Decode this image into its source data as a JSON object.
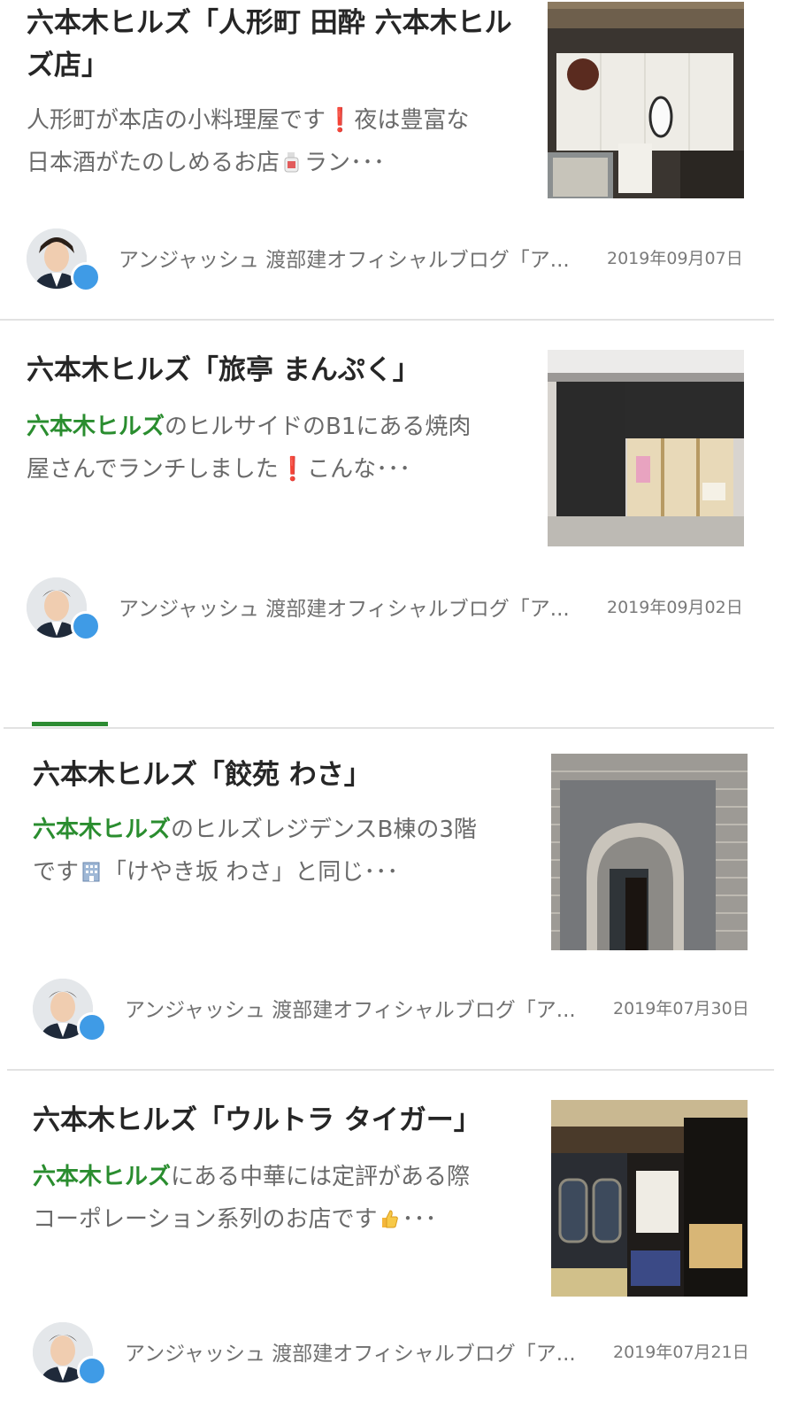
{
  "articles": [
    {
      "title": "六本木ヒルズ「人形町 田酔 六本木ヒルズ店」",
      "snippet_lead": "",
      "snippet_line1": "人形町が本店の小料理屋です❗夜は豊富な",
      "snippet_line2a": "日本酒がたのしめるお店",
      "snippet_line2b": "ラン･･･",
      "emoji_icon": "sake-bottle-icon",
      "author": "アンジャッシュ 渡部建オフィシャルブログ「ア...",
      "date": "2019年09月07日"
    },
    {
      "title": "六本木ヒルズ「旅亭 まんぷく」",
      "snippet_lead": "六本木ヒルズ",
      "snippet_line1": "のヒルサイドのB1にある焼肉",
      "snippet_line2a": "屋さんでランチしました❗こんな･･･",
      "author": "アンジャッシュ 渡部建オフィシャルブログ「ア...",
      "date": "2019年09月02日"
    },
    {
      "title": "六本木ヒルズ「餃苑 わさ」",
      "snippet_lead": "六本木ヒルズ",
      "snippet_line1": "のヒルズレジデンスB棟の3階",
      "snippet_line2a": "です",
      "snippet_line2b": "「けやき坂 わさ」と同じ･･･",
      "emoji_icon": "office-building-icon",
      "author": "アンジャッシュ 渡部建オフィシャルブログ「ア...",
      "date": "2019年07月30日"
    },
    {
      "title": "六本木ヒルズ「ウルトラ タイガー」",
      "snippet_lead": "六本木ヒルズ",
      "snippet_line1": "にある中華には定評がある際",
      "snippet_line2a": "コーポレーション系列のお店です",
      "snippet_line2b": "･･･",
      "emoji_icon": "thumbs-up-icon",
      "author": "アンジャッシュ 渡部建オフィシャルブログ「ア...",
      "date": "2019年07月21日"
    }
  ],
  "colors": {
    "highlight": "#2a8d2f",
    "title": "#262626",
    "snippet": "#6a6a6a",
    "badge": "#3f9be6",
    "divider": "#e2e2e2"
  }
}
